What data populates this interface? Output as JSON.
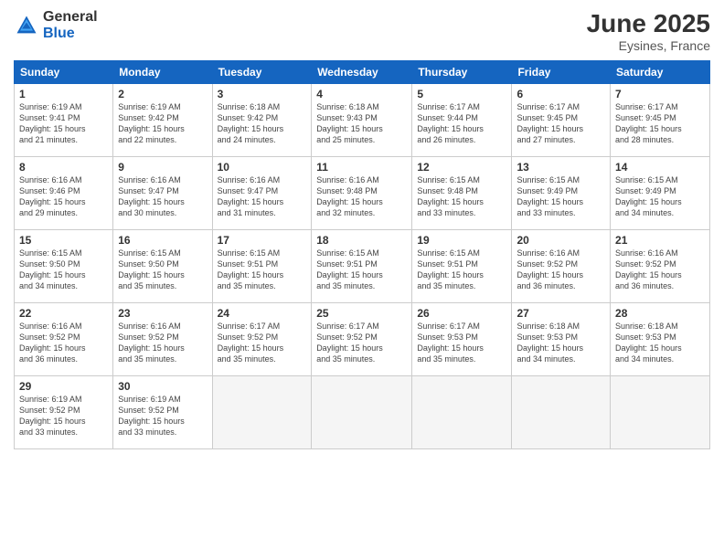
{
  "header": {
    "logo_general": "General",
    "logo_blue": "Blue",
    "month_title": "June 2025",
    "location": "Eysines, France"
  },
  "days_of_week": [
    "Sunday",
    "Monday",
    "Tuesday",
    "Wednesday",
    "Thursday",
    "Friday",
    "Saturday"
  ],
  "weeks": [
    [
      {
        "day": "1",
        "info": "Sunrise: 6:19 AM\nSunset: 9:41 PM\nDaylight: 15 hours\nand 21 minutes."
      },
      {
        "day": "2",
        "info": "Sunrise: 6:19 AM\nSunset: 9:42 PM\nDaylight: 15 hours\nand 22 minutes."
      },
      {
        "day": "3",
        "info": "Sunrise: 6:18 AM\nSunset: 9:42 PM\nDaylight: 15 hours\nand 24 minutes."
      },
      {
        "day": "4",
        "info": "Sunrise: 6:18 AM\nSunset: 9:43 PM\nDaylight: 15 hours\nand 25 minutes."
      },
      {
        "day": "5",
        "info": "Sunrise: 6:17 AM\nSunset: 9:44 PM\nDaylight: 15 hours\nand 26 minutes."
      },
      {
        "day": "6",
        "info": "Sunrise: 6:17 AM\nSunset: 9:45 PM\nDaylight: 15 hours\nand 27 minutes."
      },
      {
        "day": "7",
        "info": "Sunrise: 6:17 AM\nSunset: 9:45 PM\nDaylight: 15 hours\nand 28 minutes."
      }
    ],
    [
      {
        "day": "8",
        "info": "Sunrise: 6:16 AM\nSunset: 9:46 PM\nDaylight: 15 hours\nand 29 minutes."
      },
      {
        "day": "9",
        "info": "Sunrise: 6:16 AM\nSunset: 9:47 PM\nDaylight: 15 hours\nand 30 minutes."
      },
      {
        "day": "10",
        "info": "Sunrise: 6:16 AM\nSunset: 9:47 PM\nDaylight: 15 hours\nand 31 minutes."
      },
      {
        "day": "11",
        "info": "Sunrise: 6:16 AM\nSunset: 9:48 PM\nDaylight: 15 hours\nand 32 minutes."
      },
      {
        "day": "12",
        "info": "Sunrise: 6:15 AM\nSunset: 9:48 PM\nDaylight: 15 hours\nand 33 minutes."
      },
      {
        "day": "13",
        "info": "Sunrise: 6:15 AM\nSunset: 9:49 PM\nDaylight: 15 hours\nand 33 minutes."
      },
      {
        "day": "14",
        "info": "Sunrise: 6:15 AM\nSunset: 9:49 PM\nDaylight: 15 hours\nand 34 minutes."
      }
    ],
    [
      {
        "day": "15",
        "info": "Sunrise: 6:15 AM\nSunset: 9:50 PM\nDaylight: 15 hours\nand 34 minutes."
      },
      {
        "day": "16",
        "info": "Sunrise: 6:15 AM\nSunset: 9:50 PM\nDaylight: 15 hours\nand 35 minutes."
      },
      {
        "day": "17",
        "info": "Sunrise: 6:15 AM\nSunset: 9:51 PM\nDaylight: 15 hours\nand 35 minutes."
      },
      {
        "day": "18",
        "info": "Sunrise: 6:15 AM\nSunset: 9:51 PM\nDaylight: 15 hours\nand 35 minutes."
      },
      {
        "day": "19",
        "info": "Sunrise: 6:15 AM\nSunset: 9:51 PM\nDaylight: 15 hours\nand 35 minutes."
      },
      {
        "day": "20",
        "info": "Sunrise: 6:16 AM\nSunset: 9:52 PM\nDaylight: 15 hours\nand 36 minutes."
      },
      {
        "day": "21",
        "info": "Sunrise: 6:16 AM\nSunset: 9:52 PM\nDaylight: 15 hours\nand 36 minutes."
      }
    ],
    [
      {
        "day": "22",
        "info": "Sunrise: 6:16 AM\nSunset: 9:52 PM\nDaylight: 15 hours\nand 36 minutes."
      },
      {
        "day": "23",
        "info": "Sunrise: 6:16 AM\nSunset: 9:52 PM\nDaylight: 15 hours\nand 35 minutes."
      },
      {
        "day": "24",
        "info": "Sunrise: 6:17 AM\nSunset: 9:52 PM\nDaylight: 15 hours\nand 35 minutes."
      },
      {
        "day": "25",
        "info": "Sunrise: 6:17 AM\nSunset: 9:52 PM\nDaylight: 15 hours\nand 35 minutes."
      },
      {
        "day": "26",
        "info": "Sunrise: 6:17 AM\nSunset: 9:53 PM\nDaylight: 15 hours\nand 35 minutes."
      },
      {
        "day": "27",
        "info": "Sunrise: 6:18 AM\nSunset: 9:53 PM\nDaylight: 15 hours\nand 34 minutes."
      },
      {
        "day": "28",
        "info": "Sunrise: 6:18 AM\nSunset: 9:53 PM\nDaylight: 15 hours\nand 34 minutes."
      }
    ],
    [
      {
        "day": "29",
        "info": "Sunrise: 6:19 AM\nSunset: 9:52 PM\nDaylight: 15 hours\nand 33 minutes."
      },
      {
        "day": "30",
        "info": "Sunrise: 6:19 AM\nSunset: 9:52 PM\nDaylight: 15 hours\nand 33 minutes."
      },
      {
        "day": "",
        "info": ""
      },
      {
        "day": "",
        "info": ""
      },
      {
        "day": "",
        "info": ""
      },
      {
        "day": "",
        "info": ""
      },
      {
        "day": "",
        "info": ""
      }
    ]
  ]
}
